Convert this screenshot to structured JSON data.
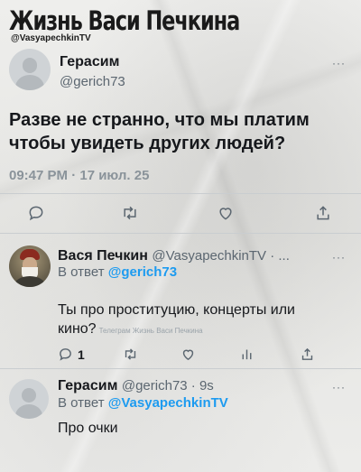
{
  "channel": {
    "title": "Жизнь Васи Печкина",
    "handle": "@VasyapechkinTV"
  },
  "tweet": {
    "author_name": "Герасим",
    "author_handle": "@gerich73",
    "more": "···",
    "text_line1": "Разве не странно, что мы платим",
    "text_line2": "чтобы увидеть других людей?",
    "timestamp": "09:47 PM · 17 июл. 25"
  },
  "reply1": {
    "author_name": "Вася Печкин",
    "author_handle": "@VasyapechkinTV · ...",
    "more": "···",
    "reply_to_prefix": "В ответ",
    "reply_to_handle": "@gerich73",
    "text_line1": "Ты про проституцию, концерты или",
    "text_line2": "кино?",
    "watermark": "Телеграм Жизнь Васи Печкина",
    "reply_count": "1"
  },
  "reply2": {
    "author_name": "Герасим",
    "author_handle": "@gerich73 · 9s",
    "more": "···",
    "reply_to_prefix": "В ответ",
    "reply_to_handle": "@VasyapechkinTV",
    "text": "Про очки"
  },
  "colors": {
    "link": "#1d9bf0",
    "secondary_text": "#5b6670",
    "primary_text": "#16181c"
  },
  "icons": [
    "reply-icon",
    "retweet-icon",
    "like-icon",
    "share-icon",
    "analytics-icon"
  ]
}
